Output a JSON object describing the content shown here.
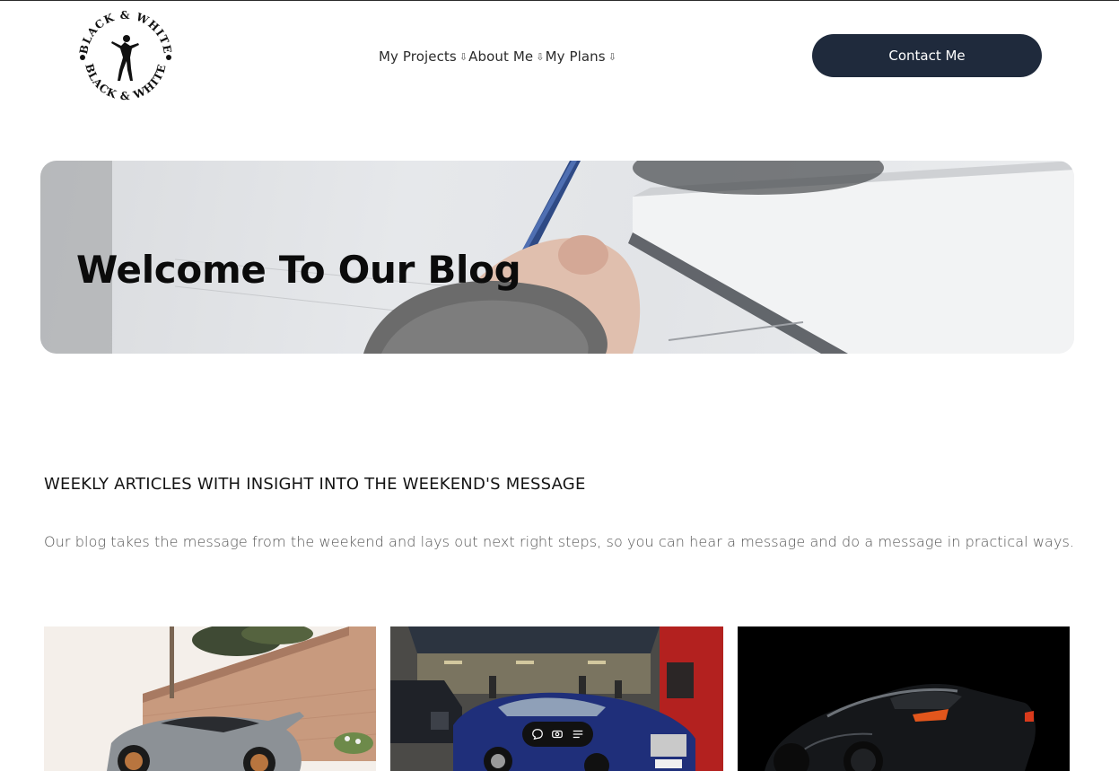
{
  "logo": {
    "top_text": "BLACK & WHITE",
    "bottom_text": "BLACK & WHITE"
  },
  "nav": {
    "items": [
      {
        "label": "My Projects",
        "arrow": "⇩"
      },
      {
        "label": "About Me",
        "arrow": "⇩"
      },
      {
        "label": "My Plans",
        "arrow": "⇩"
      }
    ]
  },
  "header": {
    "contact_label": "Contact Me"
  },
  "hero": {
    "title": "Welcome To Our Blog"
  },
  "section": {
    "heading": "WEEKLY ARTICLES WITH INSIGHT INTO THE WEEKEND'S MESSAGE",
    "description": "Our blog takes the message from the weekend and lays out next right steps, so you can hear a message and do a message in practical ways."
  },
  "cards": [
    {
      "image": "grey-supercar-image"
    },
    {
      "image": "blue-luxury-car-image"
    },
    {
      "image": "black-sports-car-image"
    }
  ],
  "float_toolbar": {
    "icons": [
      "comment-icon",
      "view-icon",
      "list-icon"
    ]
  },
  "colors": {
    "button_bg": "#1f2a3c",
    "text": "#111111",
    "muted": "#555555"
  }
}
